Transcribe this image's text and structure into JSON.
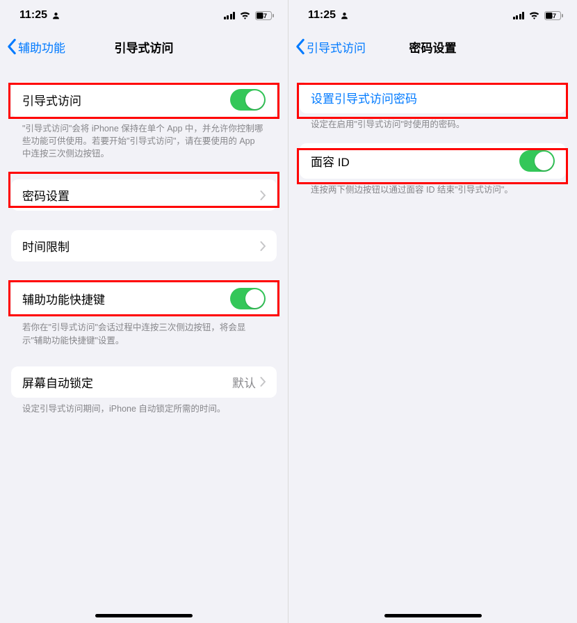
{
  "status": {
    "time": "11:25",
    "battery_pct": "47"
  },
  "left_screen": {
    "back_label": "辅助功能",
    "title": "引导式访问",
    "rows": {
      "guided_access": {
        "label": "引导式访问"
      },
      "guided_access_footer": "\"引导式访问\"会将 iPhone 保持在单个 App 中，并允许你控制哪些功能可供使用。若要开始\"引导式访问\"，请在要使用的 App 中连按三次侧边按钮。",
      "passcode": {
        "label": "密码设置"
      },
      "time_limit": {
        "label": "时间限制"
      },
      "shortcut": {
        "label": "辅助功能快捷键"
      },
      "shortcut_footer": "若你在\"引导式访问\"会话过程中连按三次侧边按钮，将会显示\"辅助功能快捷键\"设置。",
      "auto_lock": {
        "label": "屏幕自动锁定",
        "value": "默认"
      },
      "auto_lock_footer": "设定引导式访问期间，iPhone 自动锁定所需的时间。"
    }
  },
  "right_screen": {
    "back_label": "引导式访问",
    "title": "密码设置",
    "rows": {
      "set_passcode": {
        "label": "设置引导式访问密码"
      },
      "set_passcode_footer": "设定在启用\"引导式访问\"时使用的密码。",
      "face_id": {
        "label": "面容 ID"
      },
      "face_id_footer": "连按两下侧边按钮以通过面容 ID 结束\"引导式访问\"。"
    }
  }
}
